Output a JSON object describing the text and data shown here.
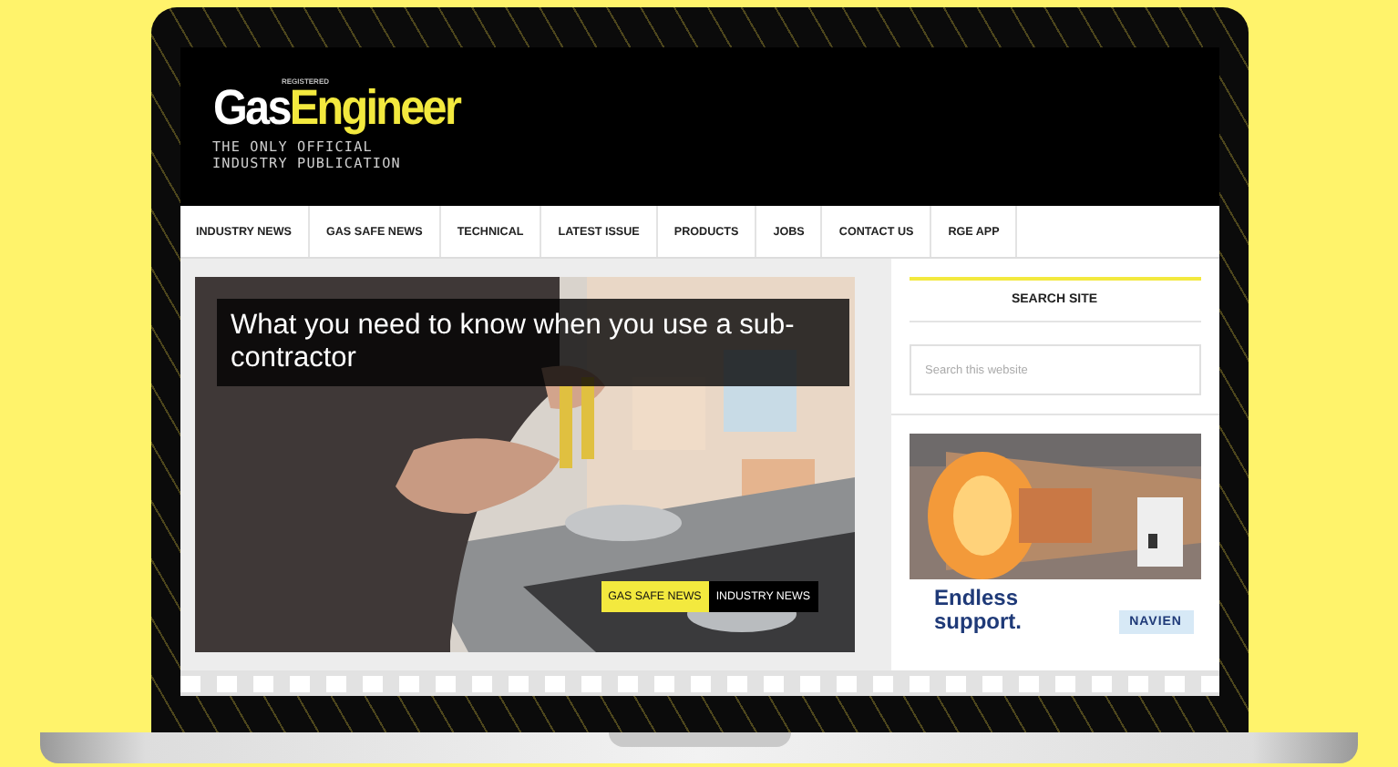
{
  "header": {
    "registered_mark": "REGISTERED",
    "logo_first": "Gas",
    "logo_second": "Engineer",
    "tagline_lines": [
      "THE ONLY OFFICIAL",
      "INDUSTRY PUBLICATION"
    ]
  },
  "nav": [
    {
      "label": "INDUSTRY NEWS"
    },
    {
      "label": "GAS SAFE NEWS"
    },
    {
      "label": "TECHNICAL"
    },
    {
      "label": "LATEST ISSUE"
    },
    {
      "label": "PRODUCTS"
    },
    {
      "label": "JOBS"
    },
    {
      "label": "CONTACT US"
    },
    {
      "label": "RGE APP"
    }
  ],
  "featured": {
    "title": "What you need to know when you use a sub-contractor",
    "tags": [
      {
        "label": "GAS SAFE NEWS",
        "color": "#f3e93e"
      },
      {
        "label": "INDUSTRY NEWS",
        "color": "#000000"
      }
    ]
  },
  "sidebar": {
    "search_heading": "SEARCH SITE",
    "search": {
      "placeholder": "Search this website"
    },
    "ad": {
      "headline": "Endless support.",
      "brand": "NAVIEN"
    }
  }
}
